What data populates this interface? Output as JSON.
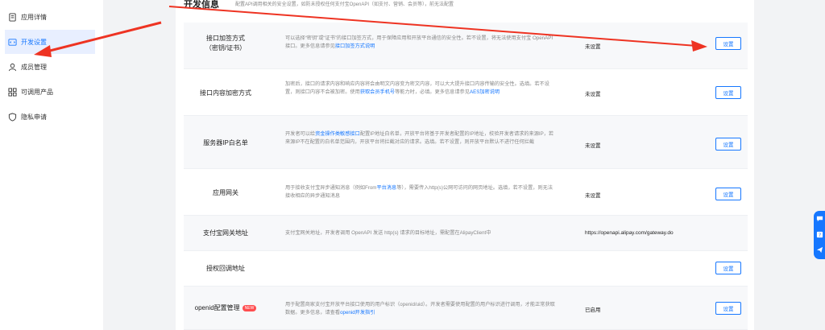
{
  "sidebar": {
    "items": [
      {
        "label": "应用详情",
        "icon": "document-icon",
        "active": false
      },
      {
        "label": "开发设置",
        "icon": "code-icon",
        "active": true
      },
      {
        "label": "成员管理",
        "icon": "user-icon",
        "active": false
      },
      {
        "label": "可调用产品",
        "icon": "grid-icon",
        "active": false
      },
      {
        "label": "隐私申请",
        "icon": "shield-icon",
        "active": false
      }
    ]
  },
  "main": {
    "title": "开发信息",
    "description": "配置API调用相关的安全设置，如防未授权任何支付宝OpenAPI（如支付、营销、会员等），前无法配置"
  },
  "rows": [
    {
      "name_line1": "接口加签方式",
      "name_line2": "（密钥/证书）",
      "desc": "可以选择“密钥”或“证书”的接口加签方式，用于保障应用和开放平台通信的安全性。若不设置，将无法使用支付宝 OpenAPI 接口。更多信息请参见",
      "desc_link": "接口加签方式说明",
      "status": "未设置",
      "button": "设置"
    },
    {
      "name_line1": "接口内容加密方式",
      "desc": "加密后，接口的请求内容和响应内容将会由明文内容变为密文内容，可以大大提升接口内容传输的安全性。选填。若不设置，则接口内容不会被加密。使用",
      "desc_link": "获取会员手机号",
      "desc_after": "等能力时，必填。更多信息请参见",
      "desc_link2": "AES加密说明",
      "status": "未设置",
      "button": "设置"
    },
    {
      "name_line1": "服务器IP白名单",
      "desc": "开发者可以给",
      "desc_link": "资金操作类敏感接口",
      "desc_after": "配置IP地址白名单，开放平台将基于开发者配置的IP地址，校验开发者请求的来源IP，若来源IP不在配置的白名单范围内，开放平台将拦截对应的请求。选填。若不设置，则开放平台默认不进行任何拦截",
      "status": "未设置",
      "button": "设置"
    },
    {
      "name_line1": "应用网关",
      "desc": "用于接收支付宝异步通知消息（例如From",
      "desc_link": "平台消息",
      "desc_after": "等），需要传入http(s)公网可访问的网页地址。选填，若不设置，则无法接收相应的异步通知消息",
      "status": "未设置",
      "button": "设置"
    },
    {
      "name_line1": "支付宝网关地址",
      "desc": "支付宝网关地址，开发者调用 OpenAPI 发送 http(s) 请求的目标地址，需配置在AlipayClient中",
      "status": "https://openapi.alipay.com/gateway.do",
      "button": ""
    },
    {
      "name_line1": "授权回调地址",
      "desc": "",
      "status": "",
      "button": "设置"
    },
    {
      "name_line1": "openid配置管理",
      "new_tag": "NEW",
      "desc": "用于配置商家支付宝开放平台接口使用的用户标识（openid/uid）。开发者需要使用配置的用户标识进行调用，才能正常获取数据。更多信息，请查看",
      "desc_link": "openid开发指引",
      "status": "已启用",
      "button": "设置"
    }
  ],
  "colors": {
    "accent": "#1677ff",
    "arrow": "#ee3322",
    "active_bg": "#e8efff"
  }
}
